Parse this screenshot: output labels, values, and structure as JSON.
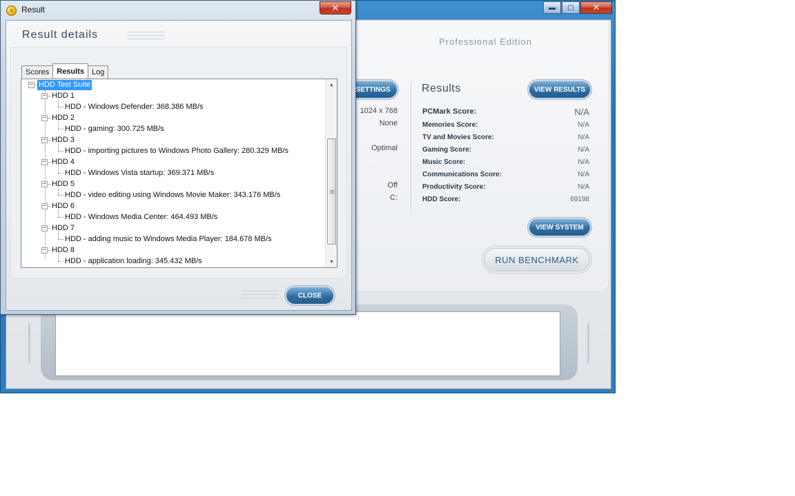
{
  "main_window": {
    "edition": "Professional Edition",
    "settings_button": "E SETTINGS",
    "settings_values": [
      "1024 x 768",
      "None",
      "Optimal",
      "Off",
      "C:"
    ],
    "results_title": "Results",
    "view_results_button": "VIEW RESULTS",
    "scores": [
      {
        "label": "PCMark Score:",
        "value": "N/A"
      },
      {
        "label": "Memories Score:",
        "value": "N/A"
      },
      {
        "label": "TV and Movies Score:",
        "value": "N/A"
      },
      {
        "label": "Gaming Score:",
        "value": "N/A"
      },
      {
        "label": "Music Score:",
        "value": "N/A"
      },
      {
        "label": "Communications Score:",
        "value": "N/A"
      },
      {
        "label": "Productivity Score:",
        "value": "N/A"
      },
      {
        "label": "HDD Score:",
        "value": "69198"
      }
    ],
    "view_system_button": "VIEW SYSTEM",
    "run_benchmark_button": "RUN BENCHMARK"
  },
  "dialog": {
    "title": "Result",
    "heading": "Result details",
    "tabs": [
      {
        "label": "Scores",
        "active": false
      },
      {
        "label": "Results",
        "active": true
      },
      {
        "label": "Log",
        "active": false
      }
    ],
    "tree": {
      "root": "HDD Test Suite",
      "groups": [
        {
          "name": "HDD 1",
          "child": "HDD - Windows Defender: 368.386 MB/s"
        },
        {
          "name": "HDD 2",
          "child": "HDD - gaming: 300.725 MB/s"
        },
        {
          "name": "HDD 3",
          "child": "HDD - importing pictures to Windows Photo Gallery: 280.329 MB/s"
        },
        {
          "name": "HDD 4",
          "child": "HDD - Windows Vista startup: 369.371 MB/s"
        },
        {
          "name": "HDD 5",
          "child": "HDD - video editing using Windows Movie Maker: 343.176 MB/s"
        },
        {
          "name": "HDD 6",
          "child": "HDD - Windows Media Center: 464.493 MB/s"
        },
        {
          "name": "HDD 7",
          "child": "HDD - adding music to Windows Media Player: 184.678 MB/s"
        },
        {
          "name": "HDD 8",
          "child": "HDD - application loading: 345.432 MB/s"
        }
      ]
    },
    "close_button": "CLOSE",
    "close_glyph": "✕",
    "expander_glyph": "−"
  },
  "caption_buttons": {
    "minimize": "▬",
    "maximize": "▢",
    "close": "✕"
  },
  "colors": {
    "accent": "#2f6ea3",
    "selection": "#3399ff",
    "titlebar": "#2f7cc0"
  }
}
